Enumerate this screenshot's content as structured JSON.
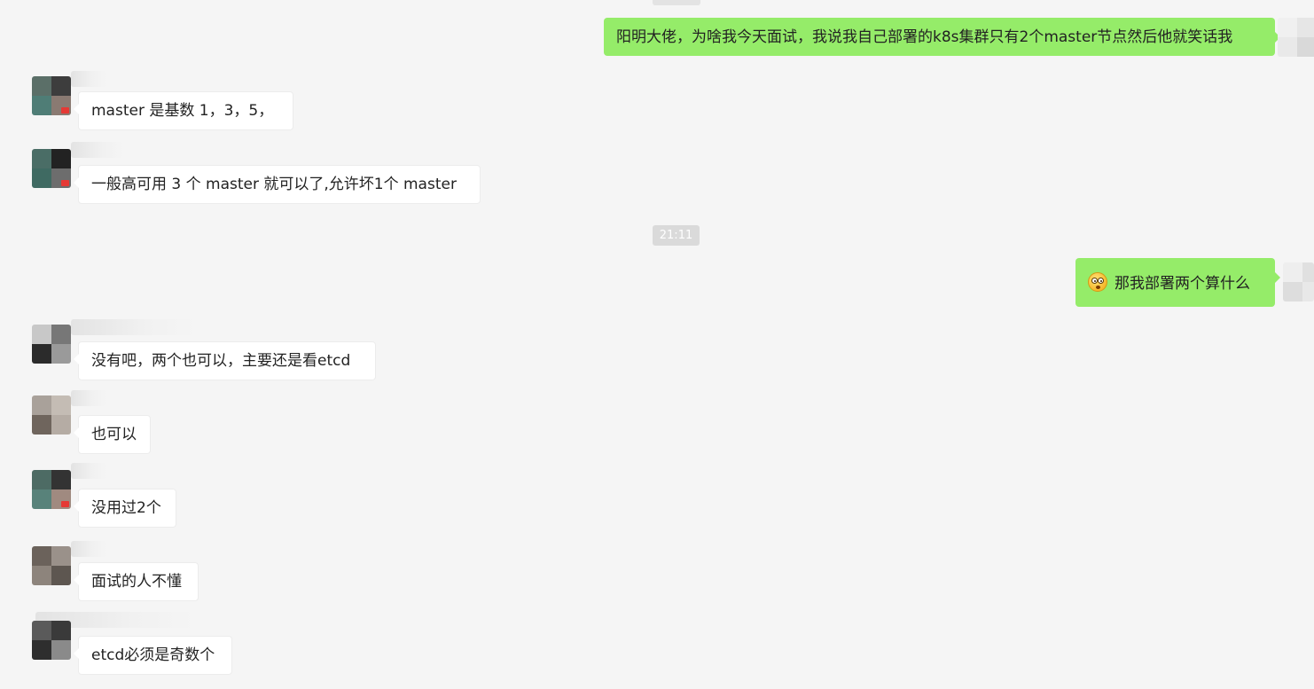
{
  "timestamp": "21:11",
  "messages": [
    {
      "direction": "out",
      "text": "阳明大佬，为啥我今天面试，我说我自己部署的k8s集群只有2个master节点然后他就笑话我"
    },
    {
      "direction": "in",
      "text": "master 是基数 1，3，5，"
    },
    {
      "direction": "in",
      "text": "一般高可用  3 个 master 就可以了,允许坏1个 master"
    },
    {
      "direction": "out",
      "emoji": "flushed-face-emoji",
      "text": "那我部署两个算什么"
    },
    {
      "direction": "in",
      "text": "没有吧，两个也可以，主要还是看etcd"
    },
    {
      "direction": "in",
      "text": "也可以"
    },
    {
      "direction": "in",
      "text": "没用过2个"
    },
    {
      "direction": "in",
      "text": "面试的人不懂"
    },
    {
      "direction": "in",
      "text": "etcd必须是奇数个"
    }
  ],
  "colors": {
    "background": "#f5f5f5",
    "outgoing_bubble": "#95ec69",
    "incoming_bubble": "#ffffff",
    "timestamp_badge": "#dadada"
  }
}
